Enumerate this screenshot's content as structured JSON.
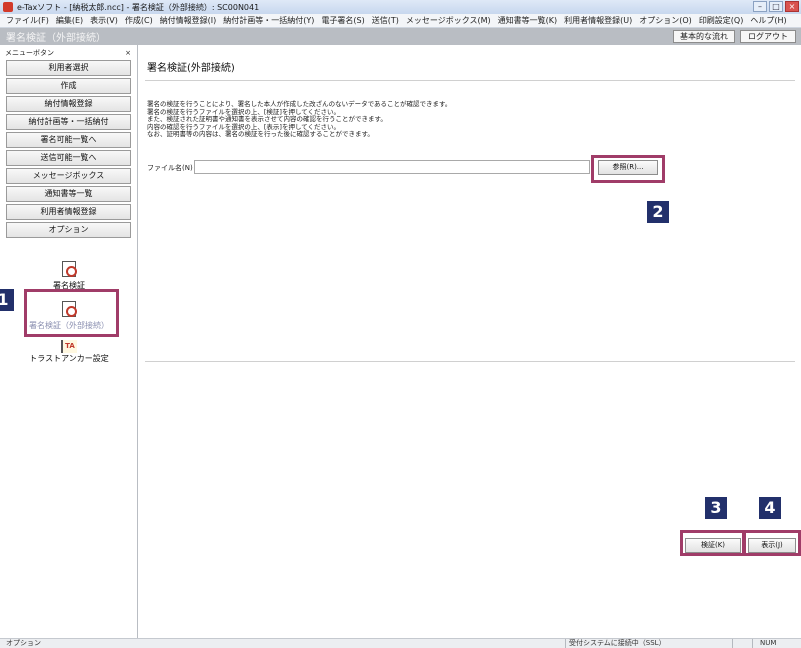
{
  "window": {
    "title": "e-Taxソフト - [納税太郎.ncc] - 署名検証（外部接続）: SC00N041",
    "controls": [
      "–",
      "□",
      "×"
    ]
  },
  "menu": [
    "ファイル(F)",
    "編集(E)",
    "表示(V)",
    "作成(C)",
    "納付情報登録(I)",
    "納付計画等・一括納付(Y)",
    "電子署名(S)",
    "送信(T)",
    "メッセージボックス(M)",
    "通知書等一覧(K)",
    "利用者情報登録(U)",
    "オプション(O)",
    "印刷設定(Q)",
    "ヘルプ(H)"
  ],
  "subheader": {
    "page_label": "署名検証（外部接続）",
    "basic_flow_button": "基本的な流れ",
    "logout_button": "ログアウト"
  },
  "sidebar": {
    "header": "メニューボタン",
    "close_glyph": "×",
    "buttons": [
      "利用者選択",
      "作成",
      "納付情報登録",
      "納付計画等・一括納付",
      "署名可能一覧へ",
      "送信可能一覧へ",
      "メッセージボックス",
      "通知書等一覧",
      "利用者情報登録",
      "オプション"
    ],
    "icon_items": [
      {
        "label": "署名検証",
        "icon": "signature-verify-icon"
      },
      {
        "label": "署名検証（外部接続）",
        "icon": "signature-verify-external-icon"
      },
      {
        "label": "トラストアンカー設定",
        "icon": "trust-anchor-icon",
        "badge": "TA"
      }
    ]
  },
  "main": {
    "title": "署名検証(外部接続)",
    "description": [
      "署名の検証を行うことにより、署名した本人が作成した改ざんのないデータであることが確認できます。",
      "署名の検証を行うファイルを選択の上、[検証]を押してください。",
      "また、検証された証明書や通知書を表示させて内容の確認を行うことができます。",
      "内容の確認を行うファイルを選択の上、[表示]を押してください。",
      "なお、証明書等の内容は、署名の検証を行った後に確認することができます。"
    ],
    "file_label": "ファイル名(N)",
    "file_value": "",
    "browse_button": "参照(R)...",
    "verify_button": "検証(K)",
    "show_button": "表示(J)"
  },
  "callouts": [
    "1",
    "2",
    "3",
    "4"
  ],
  "status": {
    "left": "オプション",
    "connection": "受付システムに接続中（SSL）",
    "num": "NUM"
  },
  "colors": {
    "callout": "#22306b",
    "highlight": "#a03c68",
    "header_bar": "#b9bdc3"
  }
}
